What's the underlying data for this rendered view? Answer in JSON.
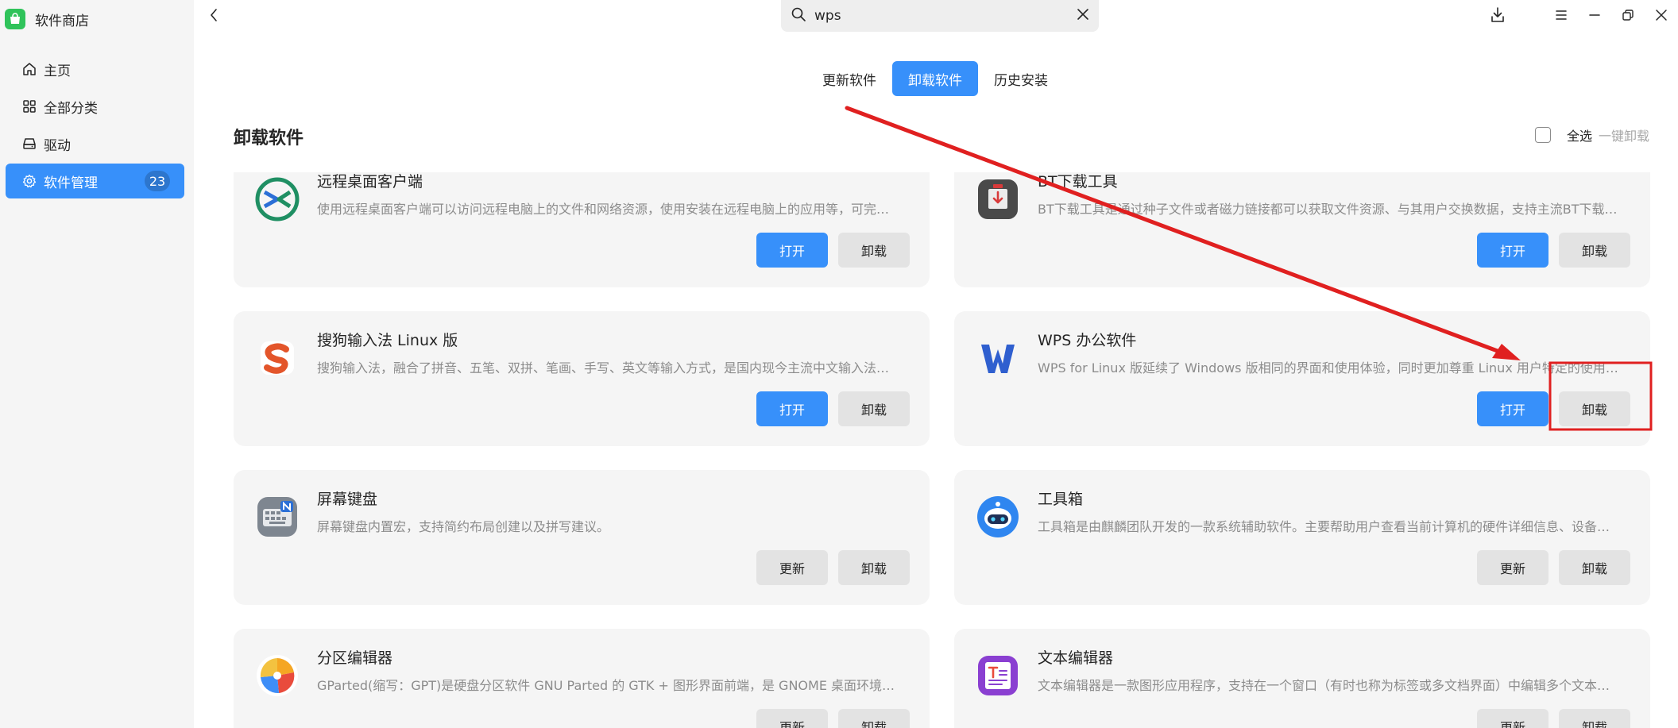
{
  "app": {
    "name": "软件商店"
  },
  "sidebar": {
    "items": [
      {
        "label": "主页",
        "icon": "home-icon"
      },
      {
        "label": "全部分类",
        "icon": "grid-icon"
      },
      {
        "label": "驱动",
        "icon": "printer-icon"
      },
      {
        "label": "软件管理",
        "icon": "gear-icon",
        "badge": "23",
        "active": true
      }
    ]
  },
  "search": {
    "value": "wps"
  },
  "tabs": [
    {
      "label": "更新软件"
    },
    {
      "label": "卸载软件",
      "active": true
    },
    {
      "label": "历史安装"
    }
  ],
  "section": {
    "title": "卸载软件",
    "select_all": "全选",
    "uninstall_all": "一键卸载"
  },
  "apps": [
    {
      "name": "远程桌面客户端",
      "desc": "使用远程桌面客户端可以访问远程电脑上的文件和网络资源，使用安装在远程电脑上的应用等，可完成远程桌面协助功能",
      "primary": "打开",
      "uninstall": "卸载",
      "icon": "remote-desktop-icon"
    },
    {
      "name": "BT下载工具",
      "desc": "BT下载工具是通过种子文件或者磁力链接都可以获取文件资源、与其用户交换数据，支持主流BT下载协议",
      "primary": "打开",
      "uninstall": "卸载",
      "icon": "bt-download-icon"
    },
    {
      "name": "搜狗输入法 Linux 版",
      "desc": "搜狗输入法，融合了拼音、五笔、双拼、笔画、手写、英文等输入方式，是国内现今主流中文输入法之一",
      "primary": "打开",
      "uninstall": "卸载",
      "icon": "sogou-icon"
    },
    {
      "name": "WPS 办公软件",
      "desc": "WPS for Linux 版延续了 Windows 版相同的界面和使用体验，同时更加尊重 Linux 用户特定的使用习惯",
      "primary": "打开",
      "uninstall": "卸载",
      "icon": "wps-icon"
    },
    {
      "name": "屏幕键盘",
      "desc": "屏幕键盘内置宏，支持简约布局创建以及拼写建议。",
      "primary": "更新",
      "uninstall": "卸载",
      "icon": "keyboard-icon"
    },
    {
      "name": "工具箱",
      "desc": "工具箱是由麒麟团队开发的一款系统辅助软件。主要帮助用户查看当前计算机的硬件详细信息、设备驱动等",
      "primary": "更新",
      "uninstall": "卸载",
      "icon": "toolbox-icon"
    },
    {
      "name": "分区编辑器",
      "desc": "GParted(缩写：GPT)是硬盘分区软件 GNU Parted 的 GTK + 图形界面前端，是 GNOME 桌面环境的默认分区工具",
      "primary": "更新",
      "uninstall": "卸载",
      "icon": "partition-icon"
    },
    {
      "name": "文本编辑器",
      "desc": "文本编辑器是一款图形应用程序，支持在一个窗口（有时也称为标签或多文档界面）中编辑多个文本文件",
      "primary": "更新",
      "uninstall": "卸载",
      "icon": "text-editor-icon"
    }
  ],
  "annotation": {
    "color": "#e02020"
  }
}
